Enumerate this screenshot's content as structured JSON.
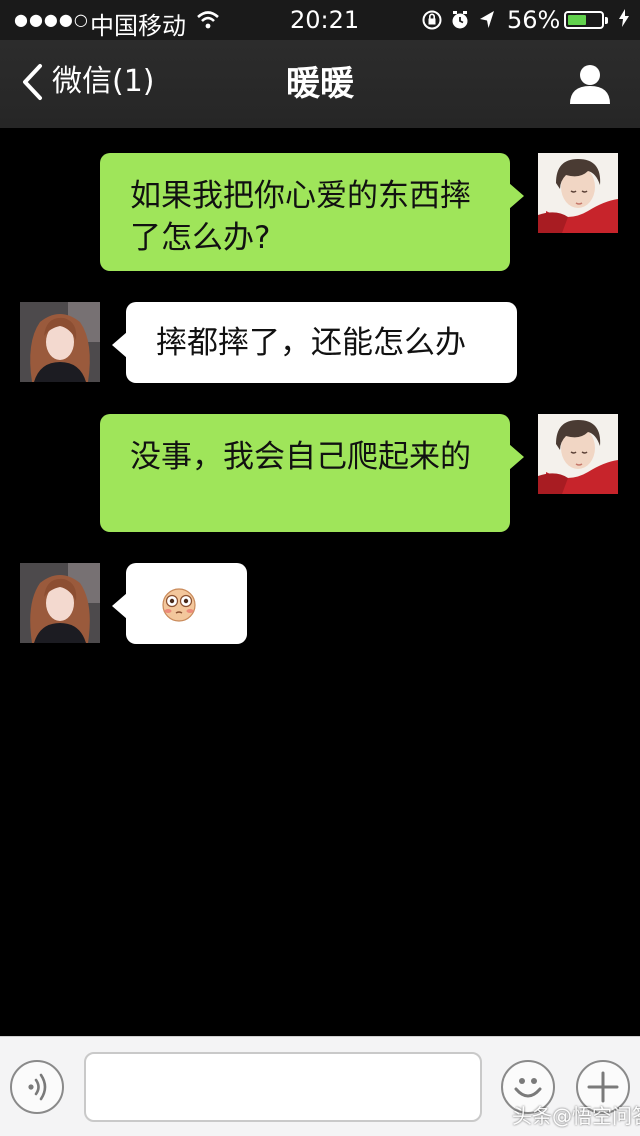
{
  "status_bar": {
    "signal": "●●●●○",
    "carrier": "中国移动",
    "time": "20:21",
    "battery_percent_text": "56%",
    "battery_level": 0.56,
    "icons": [
      "wifi-icon",
      "orientation-lock-icon",
      "alarm-icon",
      "location-arrow-icon",
      "charging-bolt-icon"
    ]
  },
  "nav": {
    "back_label": "微信(1)",
    "title": "暖暖",
    "profile_icon": "person-icon"
  },
  "messages": [
    {
      "side": "out",
      "text": "如果我把你心爱的东西摔了怎么办?"
    },
    {
      "side": "in",
      "text": "摔都摔了，还能怎么办"
    },
    {
      "side": "out",
      "text": "没事，我会自己爬起来的"
    },
    {
      "side": "in",
      "text": "",
      "emoji": "blushing-face-emoji"
    }
  ],
  "input_bar": {
    "voice_icon": "voice-icon",
    "text_value": "",
    "emoji_icon": "smiley-icon",
    "plus_icon": "plus-icon"
  },
  "watermark": "头条@悟空问答",
  "colors": {
    "outgoing_bubble": "#9fe55a",
    "incoming_bubble": "#ffffff",
    "chat_background": "#000000",
    "nav_background": "#2a2a2a"
  }
}
